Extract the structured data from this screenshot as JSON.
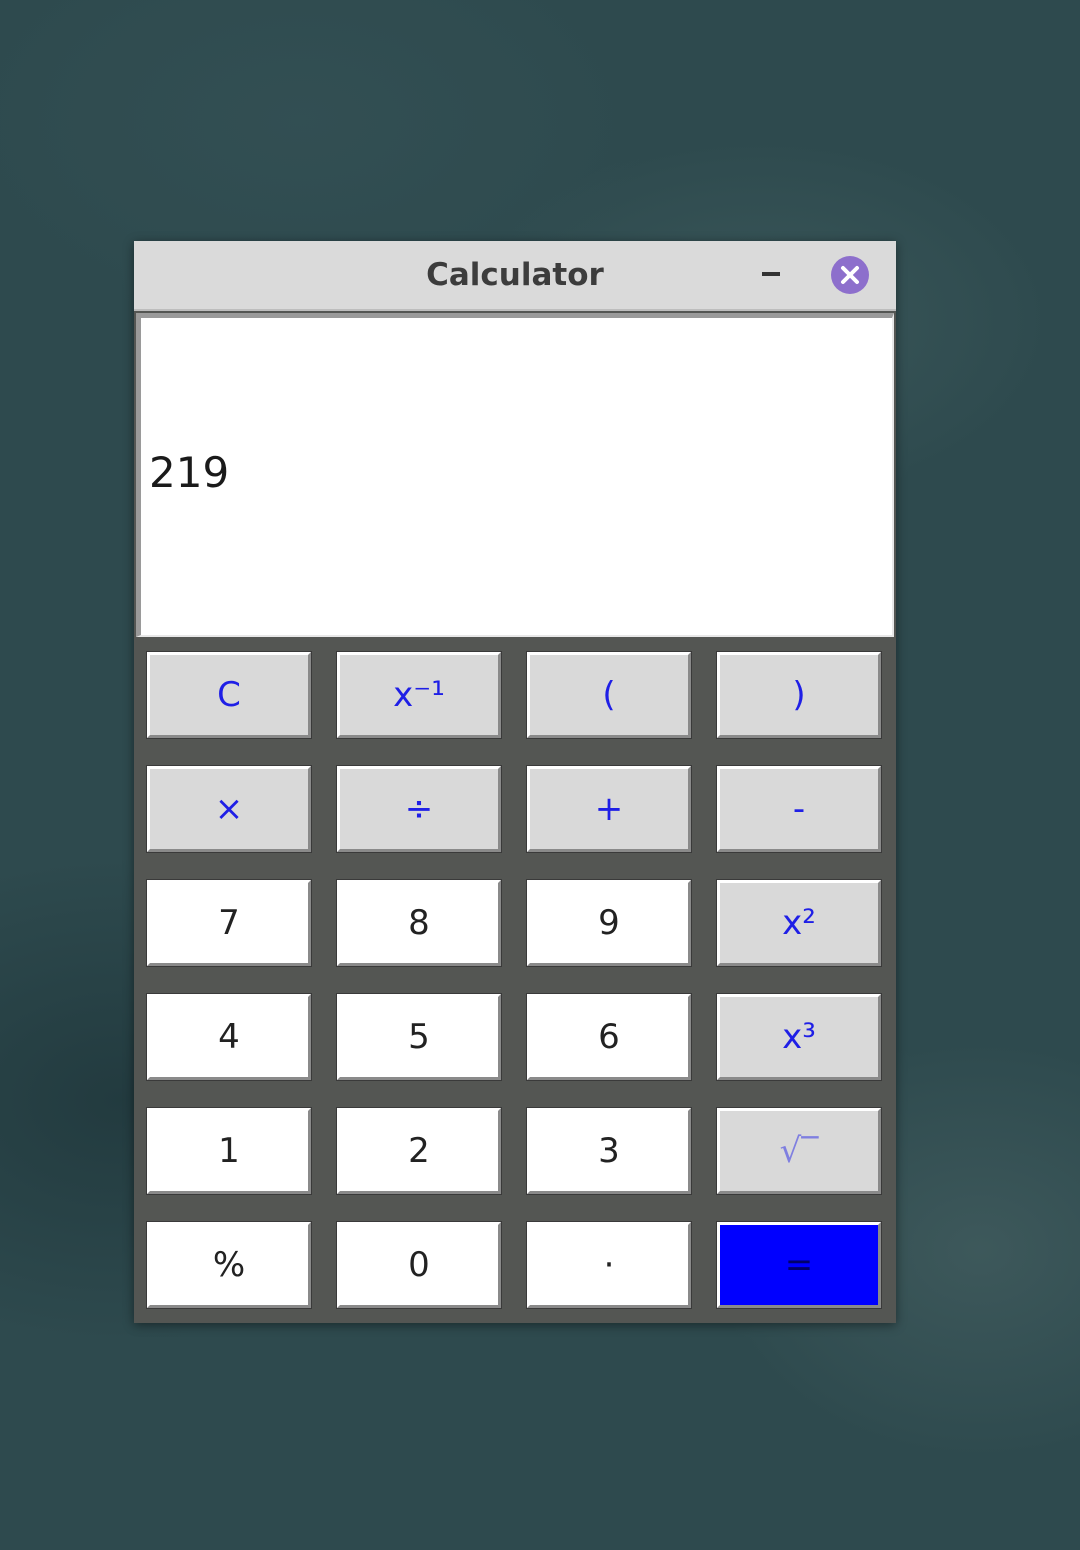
{
  "window": {
    "title": "Calculator"
  },
  "display": {
    "value": "219"
  },
  "keys": [
    {
      "label": "C",
      "style": "op"
    },
    {
      "label": "x⁻¹",
      "style": "op"
    },
    {
      "label": "(",
      "style": "op"
    },
    {
      "label": ")",
      "style": "op"
    },
    {
      "label": "×",
      "style": "op"
    },
    {
      "label": "÷",
      "style": "op"
    },
    {
      "label": "+",
      "style": "op"
    },
    {
      "label": "-",
      "style": "op"
    },
    {
      "label": "7",
      "style": "num"
    },
    {
      "label": "8",
      "style": "num"
    },
    {
      "label": "9",
      "style": "num"
    },
    {
      "label": "x²",
      "style": "op"
    },
    {
      "label": "4",
      "style": "num"
    },
    {
      "label": "5",
      "style": "num"
    },
    {
      "label": "6",
      "style": "num"
    },
    {
      "label": "x³",
      "style": "op"
    },
    {
      "label": "1",
      "style": "num"
    },
    {
      "label": "2",
      "style": "num"
    },
    {
      "label": "3",
      "style": "num"
    },
    {
      "label": "√‾",
      "style": "dim"
    },
    {
      "label": "%",
      "style": "num"
    },
    {
      "label": "0",
      "style": "num"
    },
    {
      "label": "·",
      "style": "num"
    },
    {
      "label": "=",
      "style": "equals"
    }
  ],
  "icons": {
    "minimize": "minimize-icon",
    "close": "close-icon"
  },
  "colors": {
    "operator_text": "#1f1fe6",
    "equals_background": "#0000ff",
    "close_button": "#8d6fcc",
    "keypad_background": "#545653"
  }
}
